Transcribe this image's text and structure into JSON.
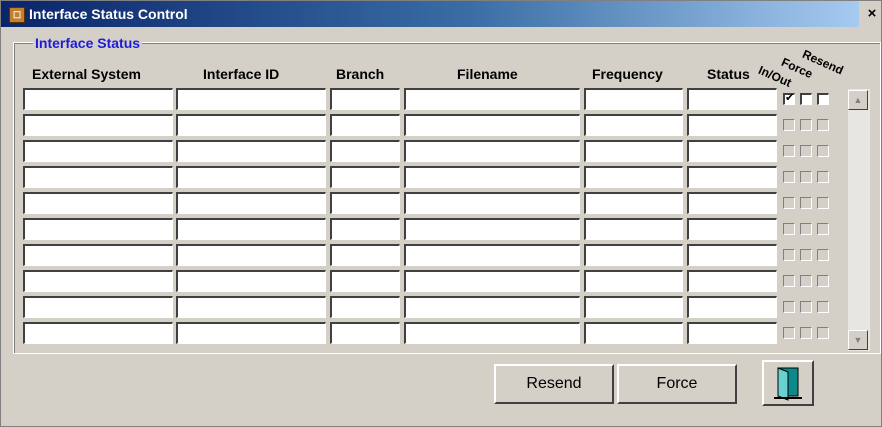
{
  "window": {
    "title": "Interface Status Control",
    "app_icon": "form-icon",
    "close_glyph": "×"
  },
  "group": {
    "label": "Interface Status"
  },
  "columns": {
    "external_system": "External System",
    "interface_id": "Interface ID",
    "branch": "Branch",
    "filename": "Filename",
    "frequency": "Frequency",
    "status": "Status",
    "in_out": "In/Out",
    "force": "Force",
    "resend": "Resend"
  },
  "rows": [
    {
      "external_system": "",
      "interface_id": "",
      "branch": "",
      "filename": "",
      "frequency": "",
      "status": "",
      "in_out": true,
      "force": false,
      "resend": false
    },
    {
      "external_system": "",
      "interface_id": "",
      "branch": "",
      "filename": "",
      "frequency": "",
      "status": "",
      "in_out": false,
      "force": false,
      "resend": false
    },
    {
      "external_system": "",
      "interface_id": "",
      "branch": "",
      "filename": "",
      "frequency": "",
      "status": "",
      "in_out": false,
      "force": false,
      "resend": false
    },
    {
      "external_system": "",
      "interface_id": "",
      "branch": "",
      "filename": "",
      "frequency": "",
      "status": "",
      "in_out": false,
      "force": false,
      "resend": false
    },
    {
      "external_system": "",
      "interface_id": "",
      "branch": "",
      "filename": "",
      "frequency": "",
      "status": "",
      "in_out": false,
      "force": false,
      "resend": false
    },
    {
      "external_system": "",
      "interface_id": "",
      "branch": "",
      "filename": "",
      "frequency": "",
      "status": "",
      "in_out": false,
      "force": false,
      "resend": false
    },
    {
      "external_system": "",
      "interface_id": "",
      "branch": "",
      "filename": "",
      "frequency": "",
      "status": "",
      "in_out": false,
      "force": false,
      "resend": false
    },
    {
      "external_system": "",
      "interface_id": "",
      "branch": "",
      "filename": "",
      "frequency": "",
      "status": "",
      "in_out": false,
      "force": false,
      "resend": false
    },
    {
      "external_system": "",
      "interface_id": "",
      "branch": "",
      "filename": "",
      "frequency": "",
      "status": "",
      "in_out": false,
      "force": false,
      "resend": false
    },
    {
      "external_system": "",
      "interface_id": "",
      "branch": "",
      "filename": "",
      "frequency": "",
      "status": "",
      "in_out": false,
      "force": false,
      "resend": false
    }
  ],
  "buttons": {
    "resend": "Resend",
    "force": "Force",
    "exit_icon": "exit-door-icon"
  },
  "colors": {
    "title_bar": "#0a246a",
    "group_label": "#1d1bd9",
    "face": "#d4d0c8"
  }
}
